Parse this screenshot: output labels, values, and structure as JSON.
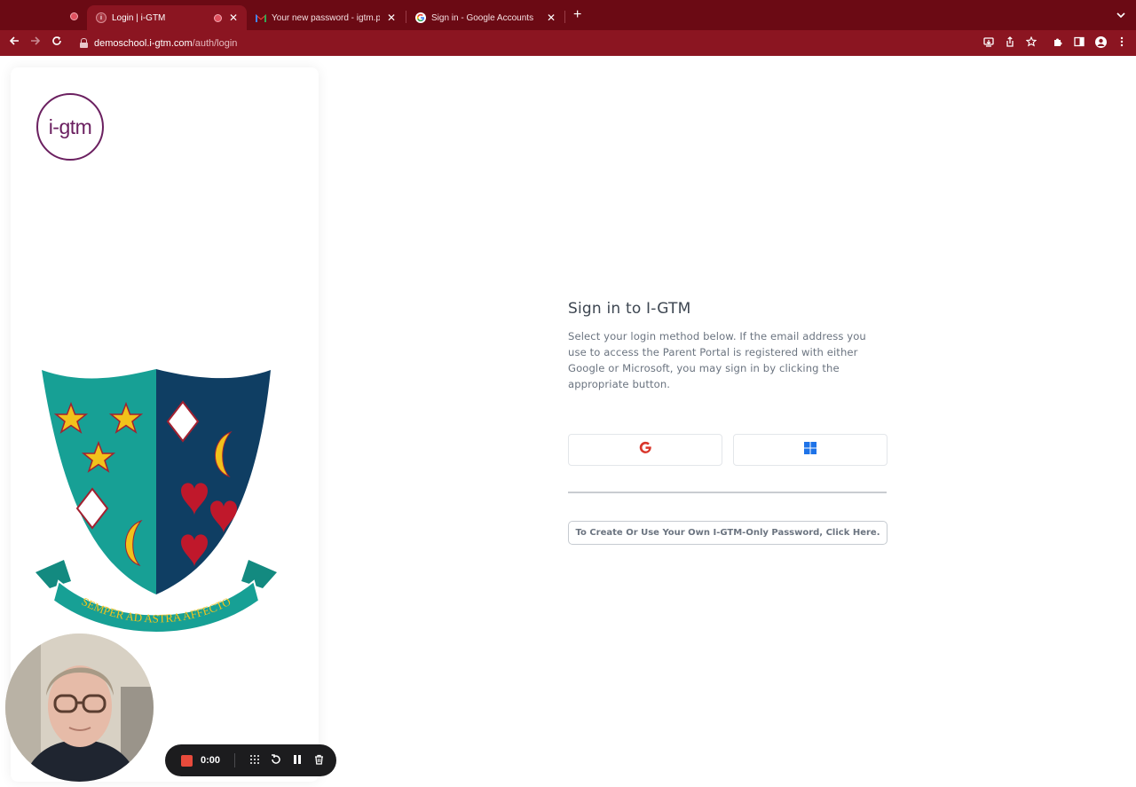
{
  "browser": {
    "tabs": [
      {
        "title": "Login | i-GTM",
        "active": true,
        "favicon": "igtm-favicon",
        "recording": true
      },
      {
        "title": "Your new password - igtm.par",
        "active": false,
        "favicon": "gmail-icon"
      },
      {
        "title": "Sign in - Google Accounts",
        "active": false,
        "favicon": "google-icon"
      }
    ],
    "url_host": "demoschool.i-gtm.com",
    "url_path": "/auth/login",
    "accent_color": "#8b1521"
  },
  "brand": {
    "logo_text": "i-gtm",
    "crest_motto": "SEMPER AD ASTRA AFFECTO"
  },
  "signin": {
    "title": "Sign in to I-GTM",
    "description": "Select your login method below. If the email address you use to access the Parent Portal is registered with either Google or Microsoft, you may sign in by clicking the appropriate button.",
    "own_password_label": "To Create Or Use Your Own I-GTM-Only Password, Click Here."
  },
  "recorder": {
    "time": "0:00"
  }
}
